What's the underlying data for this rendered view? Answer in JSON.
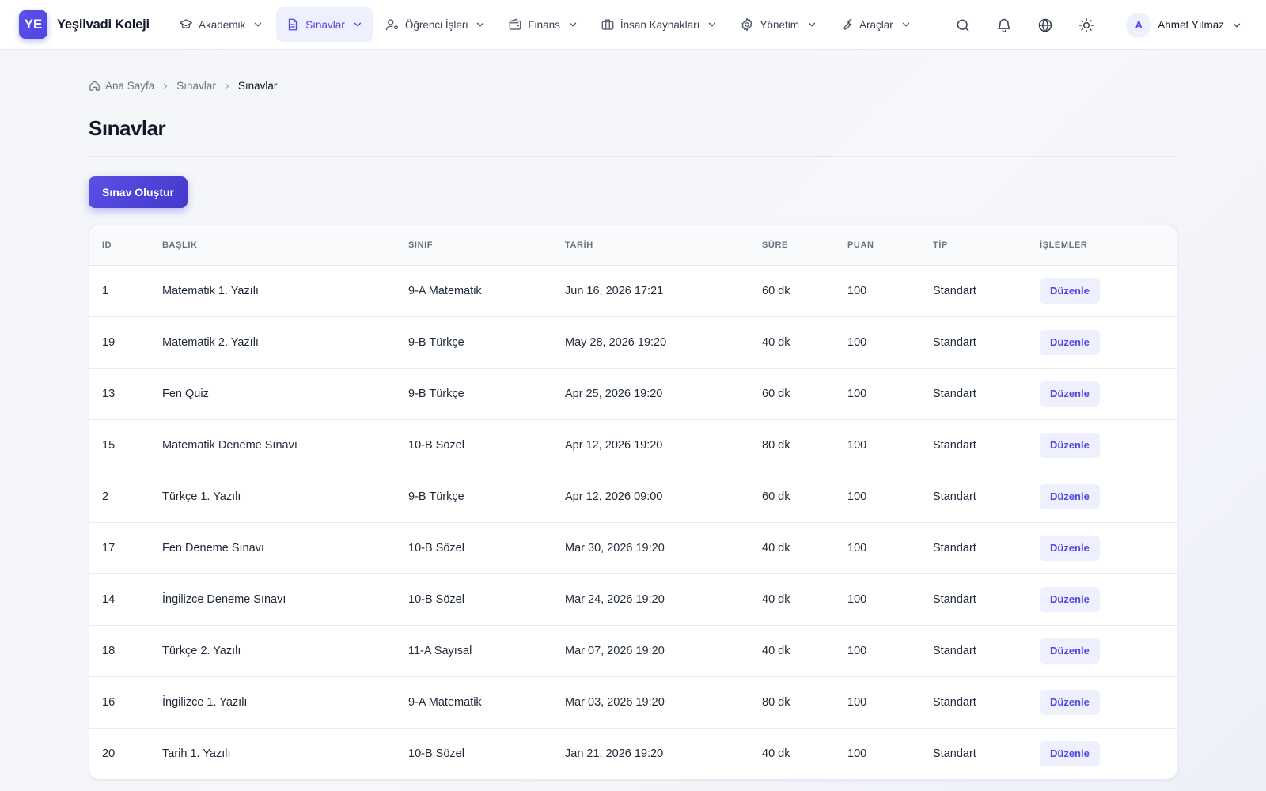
{
  "brand": {
    "logo_text": "YE",
    "name": "Yeşilvadi Koleji",
    "accent": "#4f46e5"
  },
  "nav": [
    {
      "label": "Akademik",
      "icon": "graduation-cap-icon"
    },
    {
      "label": "Sınavlar",
      "icon": "document-icon",
      "active": true
    },
    {
      "label": "Öğrenci İşleri",
      "icon": "user-cog-icon"
    },
    {
      "label": "Finans",
      "icon": "wallet-icon"
    },
    {
      "label": "İnsan Kaynakları",
      "icon": "briefcase-icon"
    },
    {
      "label": "Yönetim",
      "icon": "gear-icon"
    },
    {
      "label": "Araçlar",
      "icon": "wrench-icon"
    }
  ],
  "tools": [
    "search-icon",
    "bell-icon",
    "globe-icon",
    "sun-icon"
  ],
  "user": {
    "initial": "A",
    "name": "Ahmet Yılmaz"
  },
  "breadcrumb": {
    "home": "Ana Sayfa",
    "parent": "Sınavlar",
    "current": "Sınavlar"
  },
  "page": {
    "title": "Sınavlar",
    "create_label": "Sınav Oluştur"
  },
  "table": {
    "columns": [
      "ID",
      "BAŞLIK",
      "SINIF",
      "TARİH",
      "SÜRE",
      "PUAN",
      "TİP",
      "İŞLEMLER"
    ],
    "action_label": "Düzenle",
    "rows": [
      {
        "id": "1",
        "title": "Matematik 1. Yazılı",
        "class": "9-A Matematik",
        "date": "Jun 16, 2026 17:21",
        "duration": "60 dk",
        "score": "100",
        "type": "Standart"
      },
      {
        "id": "19",
        "title": "Matematik 2. Yazılı",
        "class": "9-B Türkçe",
        "date": "May 28, 2026 19:20",
        "duration": "40 dk",
        "score": "100",
        "type": "Standart"
      },
      {
        "id": "13",
        "title": "Fen Quiz",
        "class": "9-B Türkçe",
        "date": "Apr 25, 2026 19:20",
        "duration": "60 dk",
        "score": "100",
        "type": "Standart"
      },
      {
        "id": "15",
        "title": "Matematik Deneme Sınavı",
        "class": "10-B Sözel",
        "date": "Apr 12, 2026 19:20",
        "duration": "80 dk",
        "score": "100",
        "type": "Standart"
      },
      {
        "id": "2",
        "title": "Türkçe 1. Yazılı",
        "class": "9-B Türkçe",
        "date": "Apr 12, 2026 09:00",
        "duration": "60 dk",
        "score": "100",
        "type": "Standart"
      },
      {
        "id": "17",
        "title": "Fen Deneme Sınavı",
        "class": "10-B Sözel",
        "date": "Mar 30, 2026 19:20",
        "duration": "40 dk",
        "score": "100",
        "type": "Standart"
      },
      {
        "id": "14",
        "title": "İngilizce Deneme Sınavı",
        "class": "10-B Sözel",
        "date": "Mar 24, 2026 19:20",
        "duration": "40 dk",
        "score": "100",
        "type": "Standart"
      },
      {
        "id": "18",
        "title": "Türkçe 2. Yazılı",
        "class": "11-A Sayısal",
        "date": "Mar 07, 2026 19:20",
        "duration": "40 dk",
        "score": "100",
        "type": "Standart"
      },
      {
        "id": "16",
        "title": "İngilizce 1. Yazılı",
        "class": "9-A Matematik",
        "date": "Mar 03, 2026 19:20",
        "duration": "80 dk",
        "score": "100",
        "type": "Standart"
      },
      {
        "id": "20",
        "title": "Tarih 1. Yazılı",
        "class": "10-B Sözel",
        "date": "Jan 21, 2026 19:20",
        "duration": "40 dk",
        "score": "100",
        "type": "Standart"
      }
    ]
  }
}
